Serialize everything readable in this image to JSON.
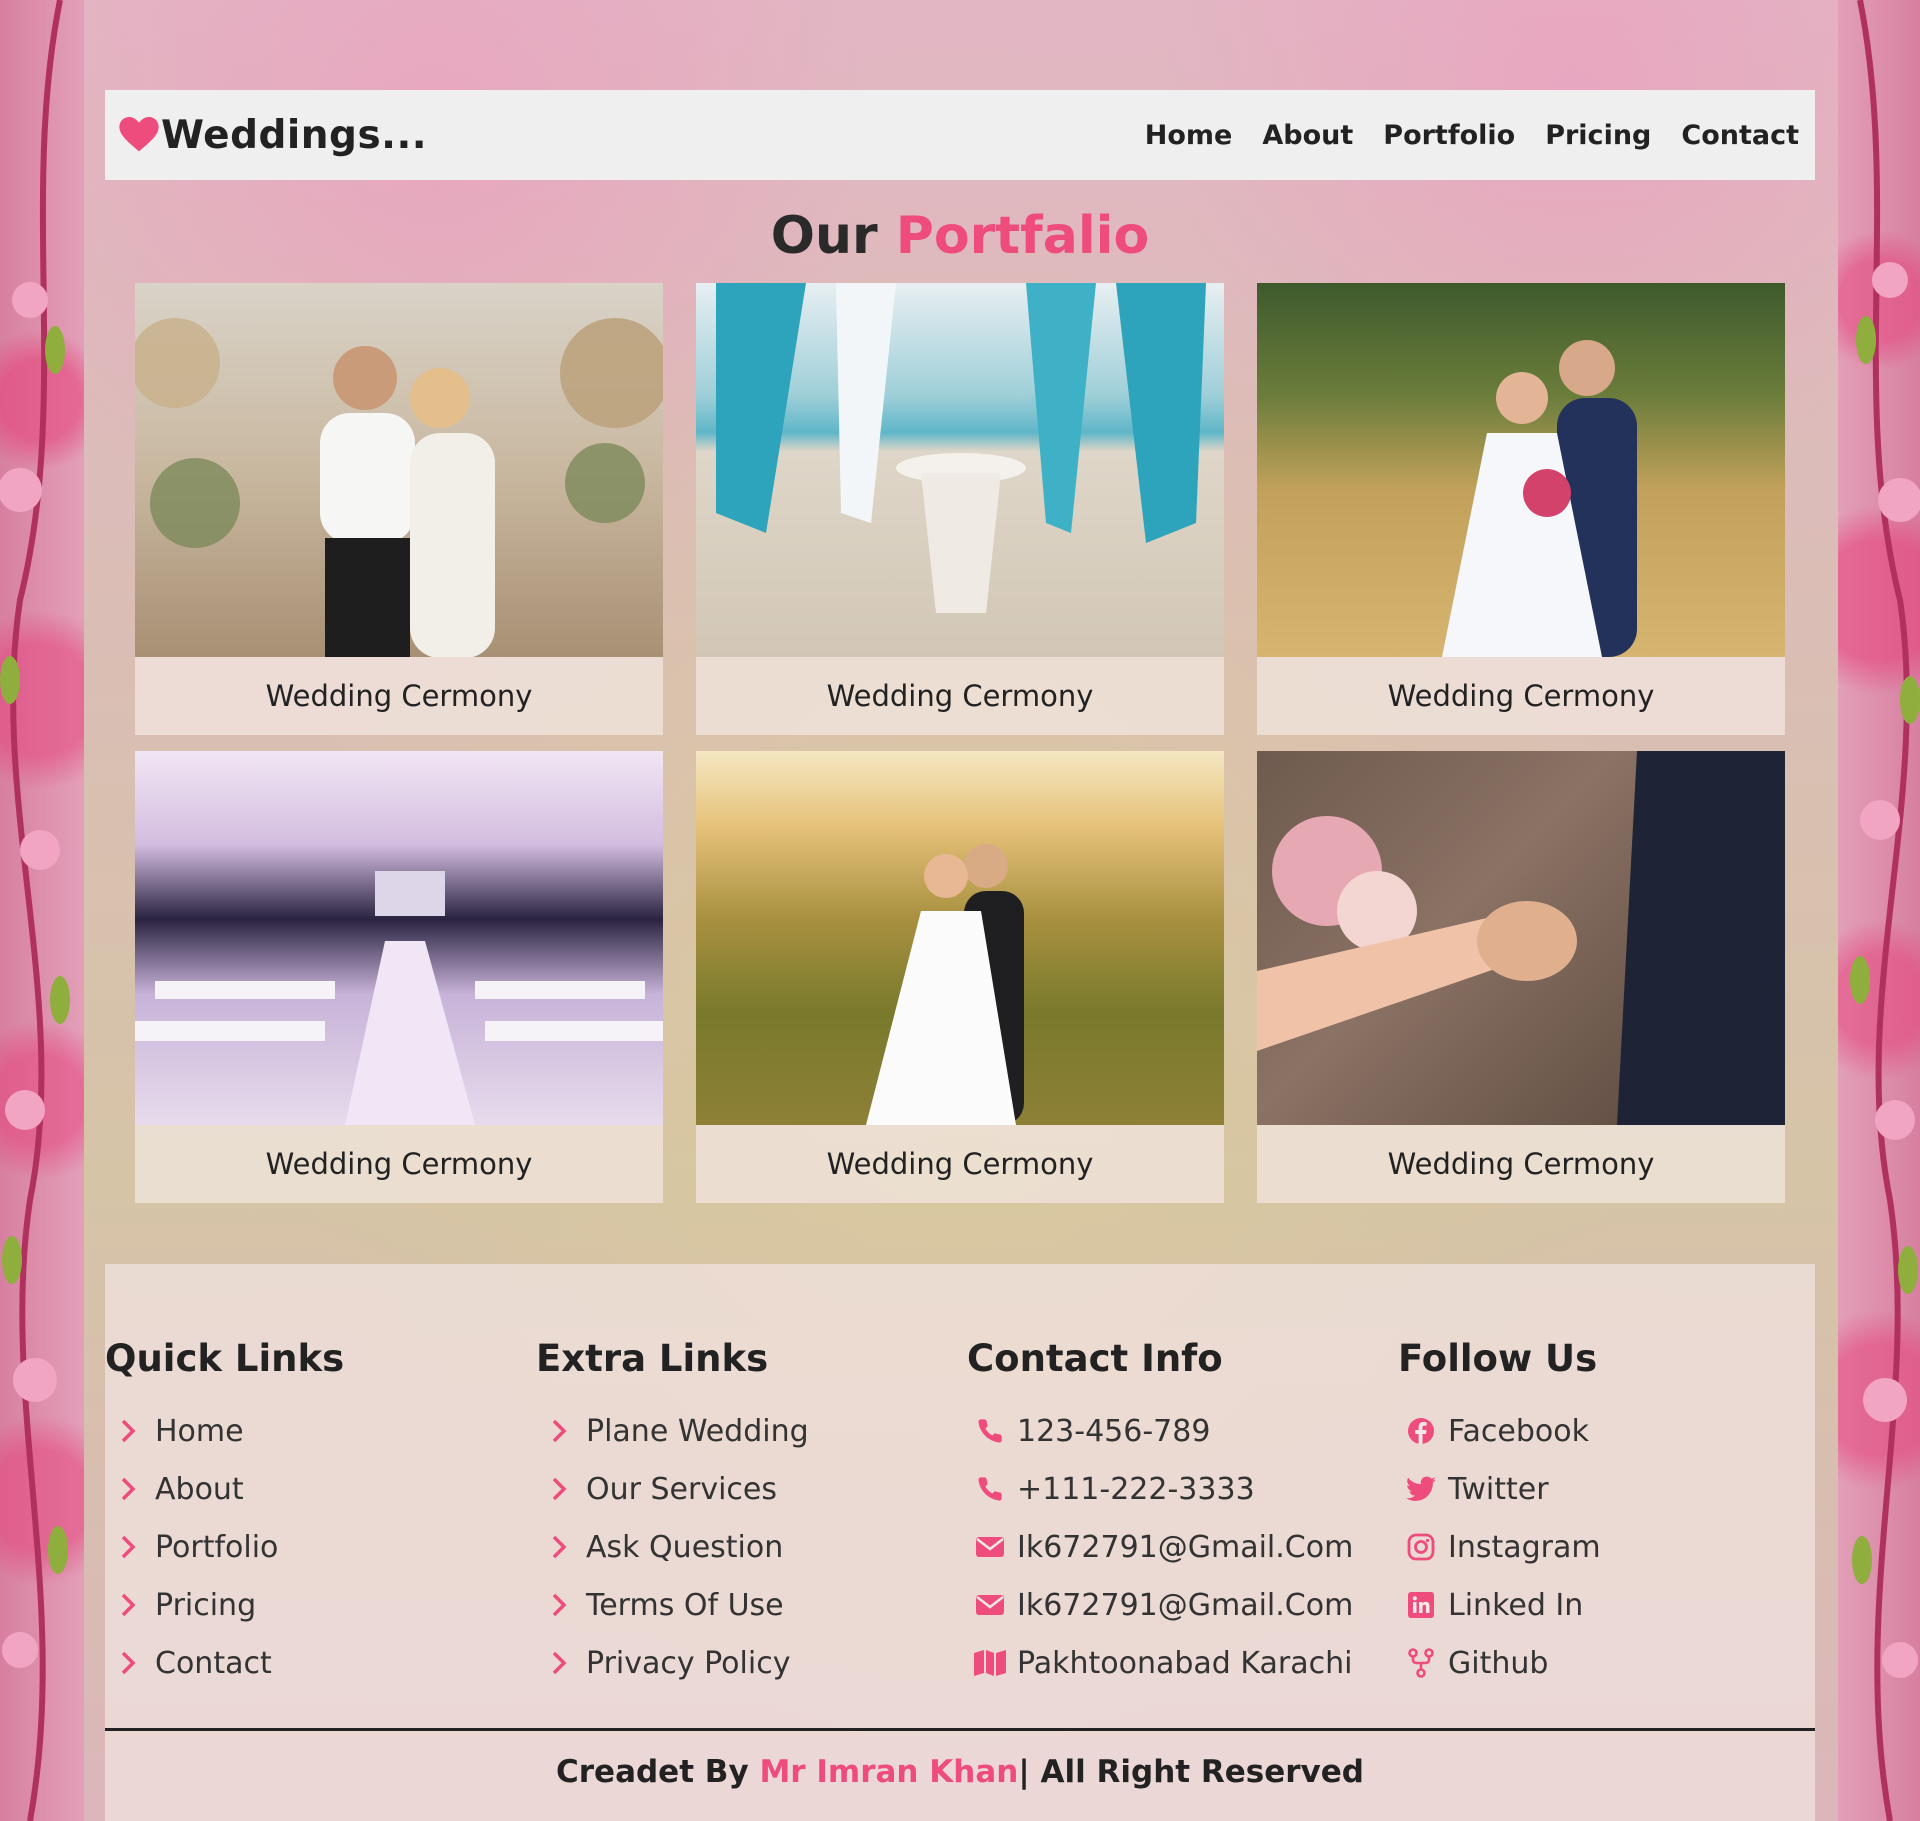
{
  "header": {
    "brand": "Weddings...",
    "nav": [
      "Home",
      "About",
      "Portfolio",
      "Pricing",
      "Contact"
    ]
  },
  "portfolio": {
    "title_main": "Our",
    "title_accent": "Portfalio",
    "cards": [
      {
        "caption": "Wedding Cermony",
        "image": "couple-floral-arch-photo"
      },
      {
        "caption": "Wedding Cermony",
        "image": "beach-ceremony-drapes-photo"
      },
      {
        "caption": "Wedding Cermony",
        "image": "couple-in-meadow-photo"
      },
      {
        "caption": "Wedding Cermony",
        "image": "reception-hall-photo"
      },
      {
        "caption": "Wedding Cermony",
        "image": "couple-sunset-hills-photo"
      },
      {
        "caption": "Wedding Cermony",
        "image": "ring-exchange-photo"
      }
    ]
  },
  "footer": {
    "quick_links": {
      "title": "Quick Links",
      "items": [
        "Home",
        "About",
        "Portfolio",
        "Pricing",
        "Contact"
      ]
    },
    "extra_links": {
      "title": "Extra Links",
      "items": [
        "Plane Wedding",
        "Our Services",
        "Ask Question",
        "Terms Of Use",
        "Privacy Policy"
      ]
    },
    "contact_info": {
      "title": "Contact Info",
      "items": [
        {
          "icon": "phone-icon",
          "text": "123-456-789"
        },
        {
          "icon": "phone-icon",
          "text": "+111-222-3333"
        },
        {
          "icon": "envelope-icon",
          "text": "Ik672791@Gmail.Com"
        },
        {
          "icon": "envelope-icon",
          "text": "Ik672791@Gmail.Com"
        },
        {
          "icon": "map-icon",
          "text": "Pakhtoonabad Karachi"
        }
      ]
    },
    "follow_us": {
      "title": "Follow Us",
      "items": [
        {
          "icon": "facebook-icon",
          "text": "Facebook"
        },
        {
          "icon": "twitter-icon",
          "text": "Twitter"
        },
        {
          "icon": "instagram-icon",
          "text": "Instagram"
        },
        {
          "icon": "linkedin-icon",
          "text": "Linked In"
        },
        {
          "icon": "github-icon",
          "text": "Github"
        }
      ]
    },
    "credit": {
      "prefix": "Creadet By",
      "author": "Mr Imran Khan",
      "suffix": "| All Right Reserved"
    }
  },
  "colors": {
    "accent": "#ee4c7c",
    "text": "#222222",
    "navbar_bg": "#efefef"
  }
}
